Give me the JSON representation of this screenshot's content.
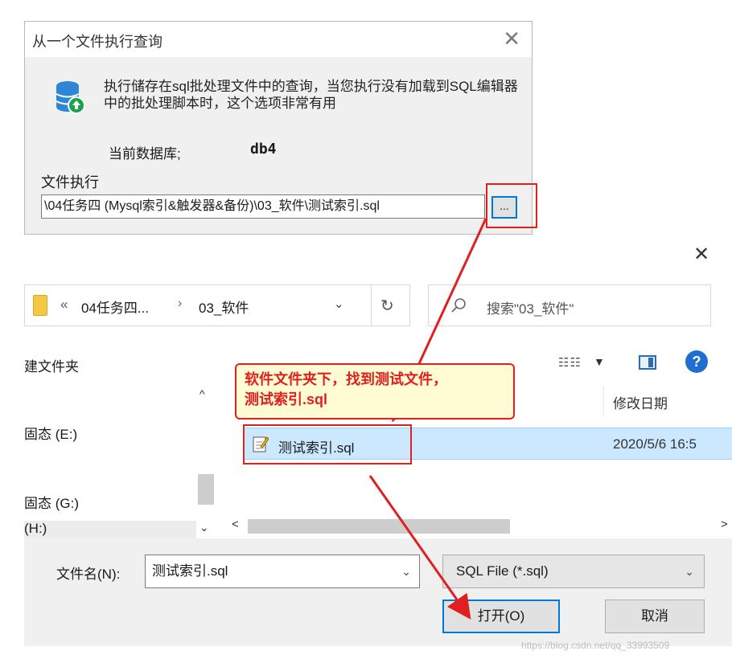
{
  "execute_dialog": {
    "title": "从一个文件执行查询",
    "close_glyph": "✕",
    "description": "执行储存在sql批处理文件中的查询，当您执行没有加载到SQL编辑器中的批处理脚本时，这个选项非常有用",
    "current_db_label": "当前数据库;",
    "current_db_value": "db4",
    "file_label": "文件执行",
    "file_path": "\\04任务四 (Mysql索引&触发器&备份)\\03_软件\\测试索引.sql",
    "browse_label": "..."
  },
  "open_dialog": {
    "close_glyph": "✕",
    "address": {
      "chevrons": "«",
      "crumb_1": "04任务四...",
      "separator": "›",
      "crumb_2": "03_软件",
      "dropdown_glyph": "⌄",
      "refresh_glyph": "↻"
    },
    "search_placeholder": "搜索\"03_软件\"",
    "toolbar": {
      "new_folder": "建文件夹",
      "view_list_glyph": "☷☷",
      "view_dropdown_glyph": "▼",
      "help_glyph": "?"
    },
    "nav": {
      "scroll_up": "^",
      "scroll_down": "⌄",
      "drives": [
        "固态 (E:)",
        "固态 (G:)",
        "(H:)"
      ]
    },
    "columns": {
      "date_modified": "修改日期"
    },
    "files": [
      {
        "name": "测试索引.sql",
        "date": "2020/5/6 16:5"
      }
    ],
    "hscroll": {
      "left": "<",
      "right": ">"
    },
    "filename_label": "文件名(N):",
    "filename_value": "测试索引.sql",
    "filetype_value": "SQL File (*.sql)",
    "dropdown_glyph": "⌄",
    "open_label": "打开(O)",
    "cancel_label": "取消"
  },
  "annotation": {
    "callout_line1": "软件文件夹下，找到测试文件，",
    "callout_line2": "测试索引.sql",
    "color": "#e02020"
  },
  "watermark": "https://blog.csdn.net/qq_33993509"
}
